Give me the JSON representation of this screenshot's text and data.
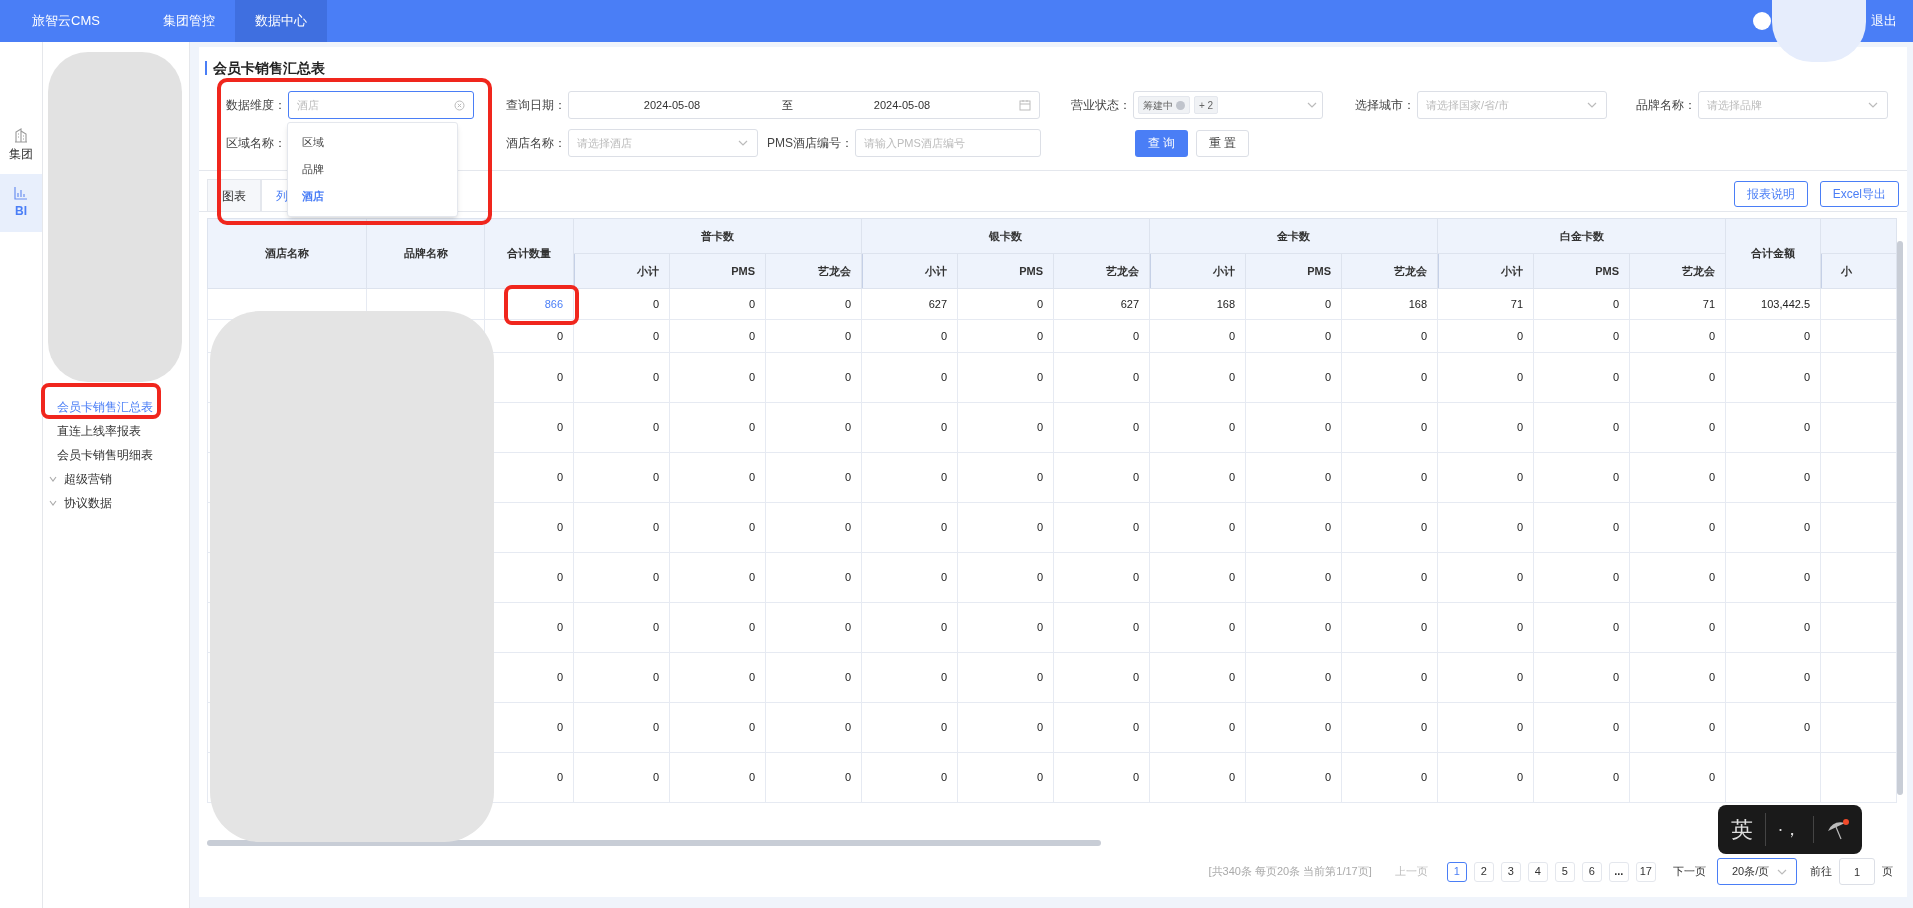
{
  "header": {
    "brand": "旅智云CMS",
    "nav": [
      {
        "label": "集团管控",
        "selected": false
      },
      {
        "label": "数据中心",
        "selected": true
      }
    ],
    "logout": "退出"
  },
  "rail": [
    {
      "label": "集团",
      "selected": false
    },
    {
      "label": "BI",
      "selected": true
    }
  ],
  "sidebar": {
    "items": [
      {
        "kind": "link",
        "label": "会员卡销售汇总表",
        "selected": true
      },
      {
        "kind": "link",
        "label": "直连上线率报表",
        "selected": false
      },
      {
        "kind": "link",
        "label": "会员卡销售明细表",
        "selected": false
      },
      {
        "kind": "group",
        "label": "超级营销",
        "expanded": false
      },
      {
        "kind": "group",
        "label": "协议数据",
        "expanded": false
      }
    ]
  },
  "page_title": "会员卡销售汇总表",
  "filters": {
    "dimension": {
      "label": "数据维度：",
      "placeholder": "酒店",
      "open": true,
      "options": [
        {
          "label": "区域",
          "selected": false
        },
        {
          "label": "品牌",
          "selected": false
        },
        {
          "label": "酒店",
          "selected": true
        }
      ]
    },
    "date": {
      "label": "查询日期：",
      "start": "2024-05-08",
      "separator": "至",
      "end": "2024-05-08"
    },
    "status": {
      "label": "营业状态：",
      "tags": [
        "筹建中"
      ],
      "more": "+ 2"
    },
    "city": {
      "label": "选择城市：",
      "placeholder": "请选择国家/省/市"
    },
    "brand": {
      "label": "品牌名称：",
      "placeholder": "请选择品牌"
    },
    "region": {
      "label": "区域名称："
    },
    "hotel": {
      "label": "酒店名称：",
      "placeholder": "请选择酒店"
    },
    "pms": {
      "label": "PMS酒店编号：",
      "placeholder": "请输入PMS酒店编号"
    },
    "search_button": "查 询",
    "reset_button": "重 置"
  },
  "tabs": [
    {
      "label": "图表",
      "selected": false
    },
    {
      "label": "列",
      "selected": true
    }
  ],
  "actions": [
    "报表说明",
    "Excel导出"
  ],
  "table": {
    "column_groups": [
      {
        "label": "普卡数"
      },
      {
        "label": "银卡数"
      },
      {
        "label": "金卡数"
      },
      {
        "label": "白金卡数"
      }
    ],
    "columns": [
      {
        "label": "酒店名称"
      },
      {
        "label": "品牌名称"
      },
      {
        "label": "合计数量"
      },
      {
        "label": "小计",
        "kind": "sub",
        "group_start": true
      },
      {
        "label": "PMS",
        "kind": "sub",
        "group_start": false
      },
      {
        "label": "艺龙会",
        "kind": "sub",
        "group_start": false
      },
      {
        "label": "小计",
        "kind": "sub",
        "group_start": true
      },
      {
        "label": "PMS",
        "kind": "sub",
        "group_start": false
      },
      {
        "label": "艺龙会",
        "kind": "sub",
        "group_start": false
      },
      {
        "label": "小计",
        "kind": "sub",
        "group_start": true
      },
      {
        "label": "PMS",
        "kind": "sub",
        "group_start": false
      },
      {
        "label": "艺龙会",
        "kind": "sub",
        "group_start": false
      },
      {
        "label": "小计",
        "kind": "sub",
        "group_start": true
      },
      {
        "label": "PMS",
        "kind": "sub",
        "group_start": false
      },
      {
        "label": "艺龙会",
        "kind": "sub",
        "group_start": false
      },
      {
        "label": "合计金额"
      },
      {
        "label": "小",
        "kind": "sub",
        "group_start": true
      }
    ],
    "rows": [
      {
        "linked": true,
        "cells": [
          "",
          "",
          "866",
          "0",
          "0",
          "0",
          "627",
          "0",
          "627",
          "168",
          "0",
          "168",
          "71",
          "0",
          "71",
          "103,442.5",
          ""
        ]
      },
      {
        "linked": false,
        "cells": [
          "",
          "",
          "0",
          "0",
          "0",
          "0",
          "0",
          "0",
          "0",
          "0",
          "0",
          "0",
          "0",
          "0",
          "0",
          "0",
          ""
        ]
      },
      {
        "linked": false,
        "cells": [
          "",
          "",
          "0",
          "0",
          "0",
          "0",
          "0",
          "0",
          "0",
          "0",
          "0",
          "0",
          "0",
          "0",
          "0",
          "0",
          ""
        ]
      },
      {
        "linked": false,
        "cells": [
          "",
          "",
          "0",
          "0",
          "0",
          "0",
          "0",
          "0",
          "0",
          "0",
          "0",
          "0",
          "0",
          "0",
          "0",
          "0",
          ""
        ]
      },
      {
        "linked": false,
        "cells": [
          "",
          "",
          "0",
          "0",
          "0",
          "0",
          "0",
          "0",
          "0",
          "0",
          "0",
          "0",
          "0",
          "0",
          "0",
          "0",
          ""
        ]
      },
      {
        "linked": false,
        "cells": [
          "",
          "",
          "0",
          "0",
          "0",
          "0",
          "0",
          "0",
          "0",
          "0",
          "0",
          "0",
          "0",
          "0",
          "0",
          "0",
          ""
        ]
      },
      {
        "linked": false,
        "cells": [
          "",
          "",
          "0",
          "0",
          "0",
          "0",
          "0",
          "0",
          "0",
          "0",
          "0",
          "0",
          "0",
          "0",
          "0",
          "0",
          ""
        ]
      },
      {
        "linked": false,
        "cells": [
          "",
          "",
          "0",
          "0",
          "0",
          "0",
          "0",
          "0",
          "0",
          "0",
          "0",
          "0",
          "0",
          "0",
          "0",
          "0",
          ""
        ]
      },
      {
        "linked": false,
        "cells": [
          "",
          "",
          "0",
          "0",
          "0",
          "0",
          "0",
          "0",
          "0",
          "0",
          "0",
          "0",
          "0",
          "0",
          "0",
          "0",
          ""
        ]
      },
      {
        "linked": false,
        "cells": [
          "",
          "",
          "0",
          "0",
          "0",
          "0",
          "0",
          "0",
          "0",
          "0",
          "0",
          "0",
          "0",
          "0",
          "0",
          "0",
          ""
        ]
      },
      {
        "linked": false,
        "cells": [
          "",
          "",
          "0",
          "0",
          "0",
          "0",
          "0",
          "0",
          "0",
          "0",
          "0",
          "0",
          "0",
          "0",
          "0",
          "",
          ""
        ]
      }
    ]
  },
  "pagination": {
    "summary": "[共340条 每页20条 当前第1/17页]",
    "prev": "上一页",
    "prev_disabled": true,
    "pages": [
      {
        "kind": "page",
        "label": "1",
        "selected": true
      },
      {
        "kind": "page",
        "label": "2",
        "selected": false
      },
      {
        "kind": "page",
        "label": "3",
        "selected": false
      },
      {
        "kind": "page",
        "label": "4",
        "selected": false
      },
      {
        "kind": "page",
        "label": "5",
        "selected": false
      },
      {
        "kind": "page",
        "label": "6",
        "selected": false
      },
      {
        "kind": "ellipsis",
        "label": "...",
        "selected": false
      },
      {
        "kind": "page",
        "label": "17",
        "selected": false
      }
    ],
    "next": "下一页",
    "page_size": "20条/页",
    "goto_label": "前往",
    "goto_value": "1",
    "goto_suffix": "页"
  },
  "ime": {
    "mode": "英",
    "punct": "·，"
  }
}
